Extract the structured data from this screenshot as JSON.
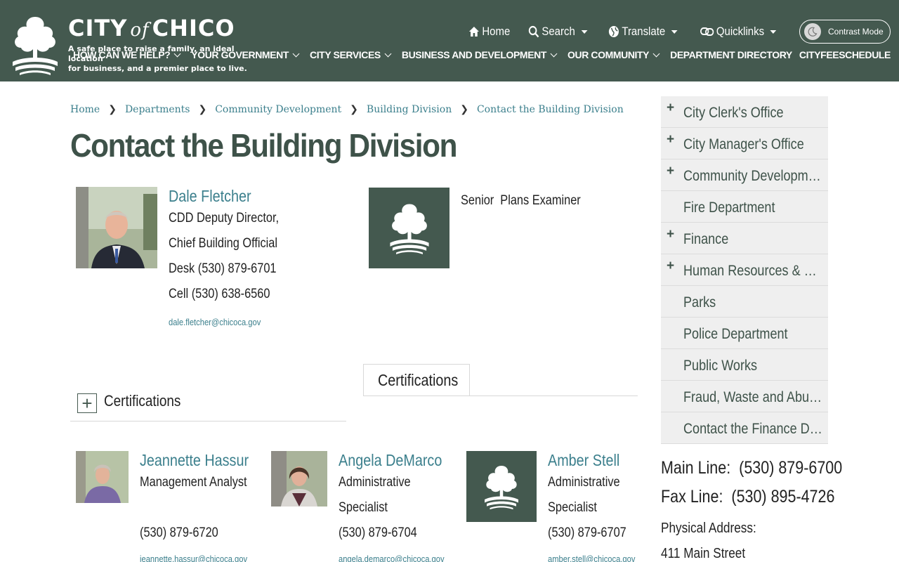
{
  "header": {
    "brand_city": "CITY",
    "brand_of": "of",
    "brand_chico": "CHICO",
    "tagline_1": "A safe place to raise a family, an ideal location",
    "tagline_2": "for business, and a premier place to live.",
    "utility": [
      {
        "label": "Home",
        "icon": "home-icon"
      },
      {
        "label": "Search",
        "icon": "search-icon"
      },
      {
        "label": "Translate",
        "icon": "globe-icon"
      },
      {
        "label": "Quicklinks",
        "icon": "link-icon"
      }
    ],
    "contrast_label": "Contrast Mode",
    "nav": [
      "HOW CAN WE HELP?",
      "YOUR GOVERNMENT",
      "CITY SERVICES",
      "BUSINESS AND DEVELOPMENT",
      "OUR COMMUNITY",
      "DEPARTMENT DIRECTORY",
      "CITYFEESCHEDULE"
    ]
  },
  "breadcrumb": [
    "Home",
    "Departments",
    "Community Development",
    "Building Division",
    "Contact the Building Division"
  ],
  "page_title": "Contact the Building Division",
  "featured": {
    "name": "Dale Fletcher",
    "title_1": "CDD Deputy Director,",
    "title_2": "Chief Building Official",
    "desk": "Desk (530) 879-6701",
    "cell": "Cell (530) 638-6560",
    "email": "dale.fletcher@chicoca.gov"
  },
  "vacant": {
    "title": "Senior  Plans Examiner"
  },
  "certifications_label": "Certifications",
  "certifications_tab": "Certifications",
  "staff": [
    {
      "name": "Jeannette Hassur",
      "title_1": "Management Analyst",
      "title_2": "",
      "phone": "(530) 879-6720",
      "email": "jeannette.hassur@chicoca.gov"
    },
    {
      "name": "Angela DeMarco",
      "title_1": "Administrative",
      "title_2": "Specialist",
      "phone": "(530) 879-6704",
      "email": "angela.demarco@chicoca.gov"
    },
    {
      "name": "Amber Stell",
      "title_1": "Administrative",
      "title_2": "Specialist",
      "phone": "(530) 879-6707",
      "email": "amber.stell@chicoca.gov"
    }
  ],
  "sidebar": [
    {
      "label": "City Clerk's Office",
      "expandable": true
    },
    {
      "label": "City Manager's Office",
      "expandable": true
    },
    {
      "label": "Community Development",
      "expandable": true
    },
    {
      "label": "Fire Department",
      "expandable": false
    },
    {
      "label": "Finance",
      "expandable": true
    },
    {
      "label": "Human Resources & Risk M...",
      "expandable": true
    },
    {
      "label": "Parks",
      "expandable": false
    },
    {
      "label": "Police Department",
      "expandable": false
    },
    {
      "label": "Public Works",
      "expandable": false
    },
    {
      "label": "Fraud, Waste and Abuse Rep...",
      "expandable": false
    },
    {
      "label": "Contact the Finance Division",
      "expandable": false
    }
  ],
  "contact": {
    "main_label": "Main Line:",
    "main_value": "(530) 879-6700",
    "fax_label": "Fax Line:",
    "fax_value": "(530) 895-4726",
    "address_label": "Physical Address:",
    "address_line": "411 Main Street"
  },
  "colors": {
    "header_bg": "#44594f",
    "link": "#3b7f8c",
    "sidebar_bg": "#efefef",
    "title": "#3e5249"
  }
}
